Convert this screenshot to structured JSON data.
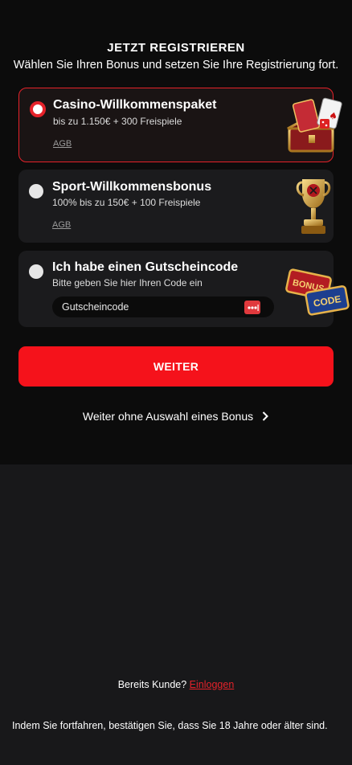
{
  "header": {
    "title": "JETZT REGISTRIEREN",
    "subtitle": "Wählen Sie Ihren Bonus und setzen Sie Ihre Registrierung fort."
  },
  "bonus_options": [
    {
      "title": "Casino-Willkommenspaket",
      "description": "bis zu 1.150€ + 300 Freispiele",
      "terms_link": "AGB",
      "selected": true,
      "art": "casino-chest-icon"
    },
    {
      "title": "Sport-Willkommensbonus",
      "description": "100% bis zu 150€ + 100 Freispiele",
      "terms_link": "AGB",
      "selected": false,
      "art": "trophy-icon"
    },
    {
      "title": "Ich habe einen Gutscheincode",
      "description": "Bitte geben Sie hier Ihren Code ein",
      "input_placeholder": "Gutscheincode",
      "input_value": "",
      "selected": false,
      "art": "bonus-code-tickets-icon",
      "art_text": [
        "BONUS",
        "CODE"
      ]
    }
  ],
  "actions": {
    "continue_label": "WEITER",
    "skip_label": "Weiter ohne Auswahl eines Bonus"
  },
  "footer": {
    "existing_customer": "Bereits Kunde?",
    "login_label": "Einloggen",
    "legal": "Indem Sie fortfahren, bestätigen Sie, dass Sie 18 Jahre oder älter sind."
  },
  "colors": {
    "accent": "#f5121b",
    "background": "#0c0c0c",
    "lower_background": "#18181a",
    "card": "#1b1b1d"
  }
}
